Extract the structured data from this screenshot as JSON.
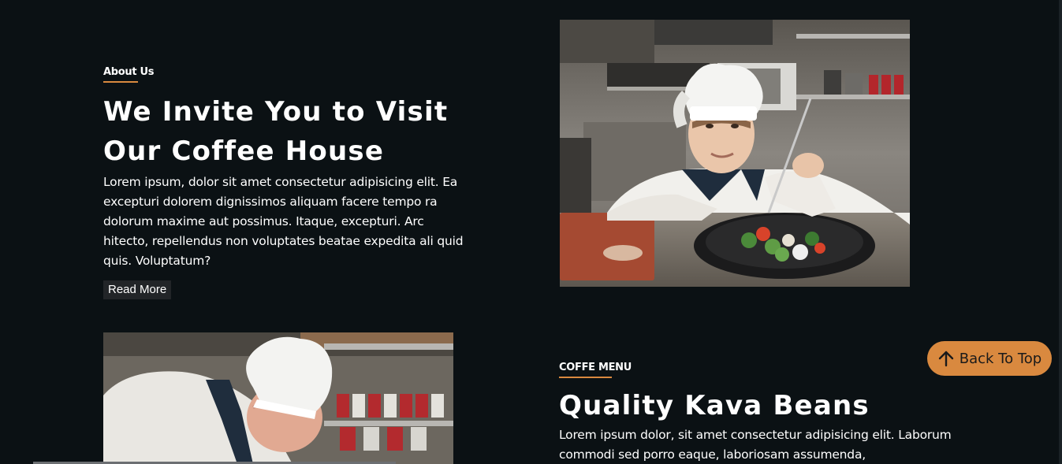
{
  "about": {
    "eyebrow": "About Us",
    "title": "We Invite You to Visit Our Coffee House",
    "text": "Lorem ipsum, dolor sit amet consectetur adipisicing elit. Ea excepturi dolorem dignissimos aliquam facere tempo ra dolorum maxime aut possimus. Itaque, excepturi. Arc hitecto, repellendus non voluptates beatae expedita ali quid quis. Voluptatum?",
    "read_more": "Read More"
  },
  "menu": {
    "eyebrow": "COFFE MENU",
    "title": "Quality Kava Beans",
    "text": "Lorem ipsum dolor, sit amet consectetur adipisicing elit. Laborum commodi sed porro eaque, laboriosam assumenda,"
  },
  "back_to_top": {
    "label": "Back To Top",
    "icon": "arrow-up-icon"
  },
  "colors": {
    "background": "#0b1114",
    "accent": "#d9893f",
    "button_bg": "#222528"
  }
}
